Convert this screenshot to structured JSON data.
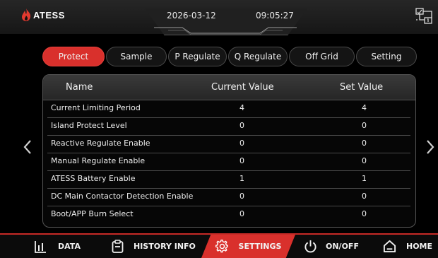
{
  "header": {
    "brand": "ATESS",
    "date": "2026-03-12",
    "time": "09:05:27",
    "brand_color": "#e23a2f"
  },
  "tabs": [
    {
      "label": "Protect",
      "active": true
    },
    {
      "label": "Sample",
      "active": false
    },
    {
      "label": "P Regulate",
      "active": false
    },
    {
      "label": "Q Regulate",
      "active": false
    },
    {
      "label": "Off Grid",
      "active": false
    },
    {
      "label": "Setting",
      "active": false
    }
  ],
  "table": {
    "columns": [
      "Name",
      "Current Value",
      "Set Value"
    ],
    "rows": [
      {
        "name": "Current Limiting Period",
        "current": "4",
        "set": "4"
      },
      {
        "name": "Island Protect Level",
        "current": "0",
        "set": "0"
      },
      {
        "name": "Reactive Regulate Enable",
        "current": "0",
        "set": "0"
      },
      {
        "name": "Manual Regulate Enable",
        "current": "0",
        "set": "0"
      },
      {
        "name": "ATESS Battery Enable",
        "current": "1",
        "set": "1"
      },
      {
        "name": "DC Main Contactor Detection Enable",
        "current": "0",
        "set": "0"
      },
      {
        "name": "Boot/APP Burn Select",
        "current": "0",
        "set": "0"
      }
    ]
  },
  "nav": [
    {
      "label": "DATA",
      "icon": "bar-chart-icon",
      "active": false
    },
    {
      "label": "HISTORY INFO",
      "icon": "clipboard-icon",
      "active": false
    },
    {
      "label": "SETTINGS",
      "icon": "gear-icon",
      "active": true
    },
    {
      "label": "ON/OFF",
      "icon": "power-icon",
      "active": false
    },
    {
      "label": "HOME",
      "icon": "home-icon",
      "active": false
    }
  ],
  "colors": {
    "accent": "#d9302c",
    "background": "#000000",
    "border": "#555555"
  }
}
